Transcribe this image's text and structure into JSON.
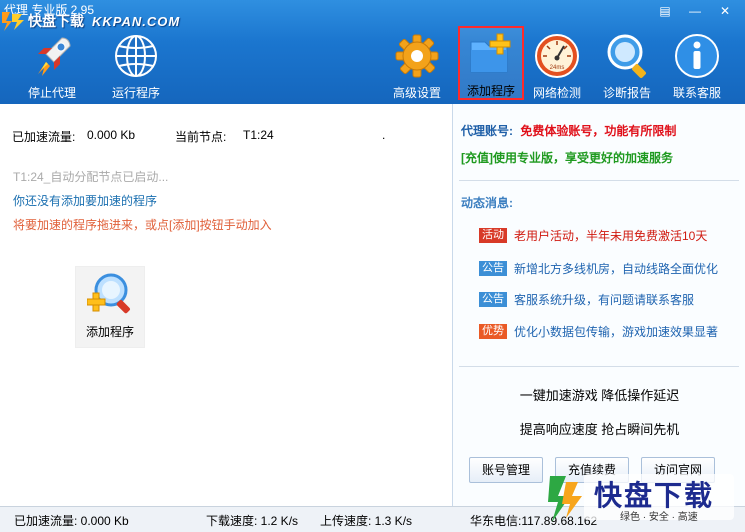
{
  "window": {
    "title": "代理 专业版 2.95",
    "controls": {
      "menu": "▤",
      "minimize": "—",
      "close": "✕"
    }
  },
  "brand": {
    "cn": "快盘下载",
    "en": "KKPAN.COM"
  },
  "toolbar": [
    {
      "id": "stop-proxy",
      "label": "停止代理",
      "icon": "rocket-icon"
    },
    {
      "id": "run-program",
      "label": "运行程序",
      "icon": "globe-icon"
    },
    {
      "id": "advanced-settings",
      "label": "高级设置",
      "icon": "gear-icon"
    },
    {
      "id": "add-program",
      "label": "添加程序",
      "icon": "folder-plus-icon",
      "active": true
    },
    {
      "id": "network-test",
      "label": "网络检测",
      "icon": "speedometer-icon"
    },
    {
      "id": "diagnose",
      "label": "诊断报告",
      "icon": "magnifier-icon"
    },
    {
      "id": "contact",
      "label": "联系客服",
      "icon": "info-icon"
    }
  ],
  "left": {
    "accel_label": "已加速流量:",
    "accel_value": "0.000 Kb",
    "node_label": "当前节点:",
    "node_value": "T1:24",
    "node_dot": ".",
    "msg_auto": "T1:24_自动分配节点已启动...",
    "msg_none": "你还没有添加要加速的程序",
    "msg_hint": "将要加速的程序拖进来，或点[添加]按钮手动加入",
    "add_tile_label": "添加程序"
  },
  "right": {
    "account_key": "代理账号:",
    "account_value": "免费体验账号，功能有所限制",
    "upgrade_tag": "[充值]",
    "upgrade_text": "使用专业版，享受更好的加速服务",
    "news_title": "动态消息:",
    "news": [
      {
        "tag": "活动",
        "tag_color": "red",
        "text": "老用户活动，半年未用免费激活10天",
        "text_color": "red"
      },
      {
        "tag": "公告",
        "tag_color": "blue",
        "text": "新增北方多线机房，自动线路全面优化",
        "text_color": "blue"
      },
      {
        "tag": "公告",
        "tag_color": "blue",
        "text": "客服系统升级，有问题请联系客服",
        "text_color": "blue"
      },
      {
        "tag": "优势",
        "tag_color": "orange",
        "text": "优化小数据包传输，游戏加速效果显著",
        "text_color": "blue"
      }
    ],
    "promo_line1": "一键加速游戏  降低操作延迟",
    "promo_line2": "提高响应速度  抢占瞬间先机",
    "buttons": {
      "account": "账号管理",
      "recharge": "充值续费",
      "website": "访问官网"
    }
  },
  "status": {
    "accel": "已加速流量: 0.000 Kb",
    "down": "下载速度: 1.2 K/s",
    "up": "上传速度: 1.3 K/s",
    "server": "华东电信:117.89.68.162"
  },
  "watermark": {
    "cn": "快盘下载",
    "sub": "绿色 · 安全 · 高速"
  },
  "colors": {
    "toolbar_bg": "#1b76cf",
    "active_border": "#ff2a2a",
    "account_red": "#e0101a",
    "upgrade_green": "#1f9a20",
    "news_title": "#3c7fc0"
  }
}
